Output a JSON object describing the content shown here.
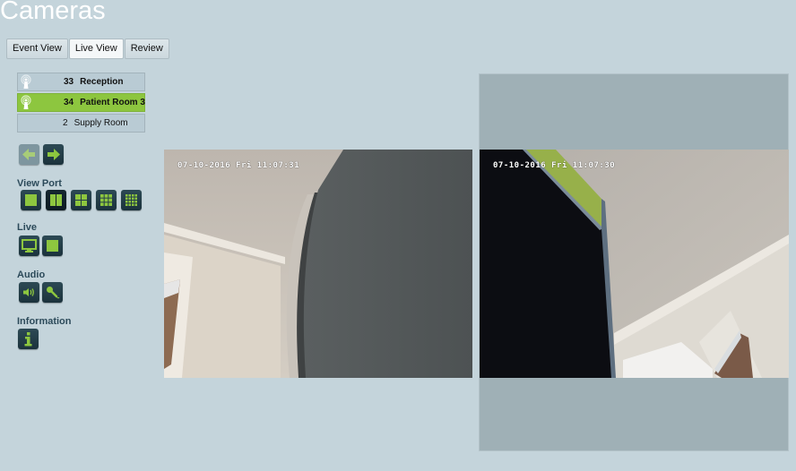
{
  "page": {
    "title": "Cameras"
  },
  "tabs": [
    {
      "label": "Event View",
      "active": false
    },
    {
      "label": "Live View",
      "active": true
    },
    {
      "label": "Review",
      "active": false
    }
  ],
  "cameras": [
    {
      "number": "33",
      "name": "Reception",
      "icon": "camera-signal-icon",
      "selected": false,
      "has_icon": true
    },
    {
      "number": "34",
      "name": "Patient Room 3",
      "icon": "camera-signal-icon",
      "selected": true,
      "has_icon": true
    },
    {
      "number": "2",
      "name": "Supply Room",
      "selected": false,
      "has_icon": false
    }
  ],
  "navigation": {
    "prev": {
      "icon": "arrow-left-icon",
      "enabled": false
    },
    "next": {
      "icon": "arrow-right-icon",
      "enabled": true
    }
  },
  "sections": {
    "viewport": {
      "label": "View Port",
      "layouts": [
        {
          "panes": 1,
          "icon": "layout-1-icon",
          "active": false
        },
        {
          "panes": 2,
          "icon": "layout-2-icon",
          "active": true
        },
        {
          "panes": 4,
          "icon": "layout-4-icon",
          "active": false
        },
        {
          "panes": 9,
          "icon": "layout-9-icon",
          "active": false
        },
        {
          "panes": 16,
          "icon": "layout-16-icon",
          "active": false
        }
      ]
    },
    "live": {
      "label": "Live",
      "buttons": [
        {
          "icon": "monitor-icon"
        },
        {
          "icon": "stop-icon"
        }
      ]
    },
    "audio": {
      "label": "Audio",
      "buttons": [
        {
          "icon": "speaker-icon"
        },
        {
          "icon": "microphone-icon"
        }
      ]
    },
    "information": {
      "label": "Information",
      "buttons": [
        {
          "icon": "info-icon"
        }
      ]
    }
  },
  "feeds": [
    {
      "camera_number": "33",
      "osd_timestamp": "07-10-2016 Fri 11:07:31"
    },
    {
      "camera_number": "34",
      "osd_timestamp": "07-10-2016 Fri 11:07:30"
    }
  ],
  "colors": {
    "background": "#c4d4db",
    "accent_green": "#8dc63f",
    "button_dark": "#1b323c",
    "label_blue": "#2c4a5a"
  }
}
